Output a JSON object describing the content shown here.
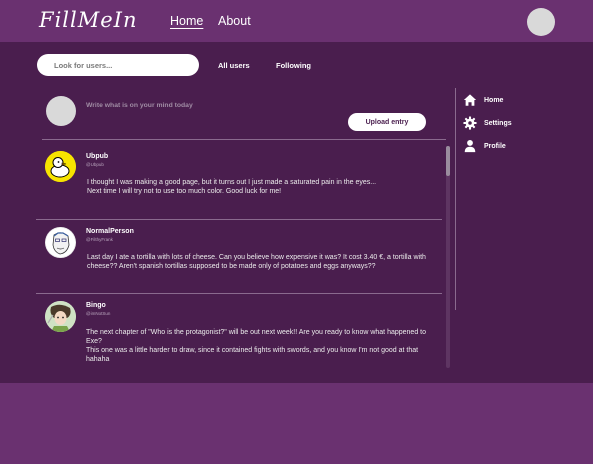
{
  "app": {
    "logo": "FillMeIn"
  },
  "nav": {
    "home": "Home",
    "about": "About"
  },
  "search": {
    "placeholder": "Look for users..."
  },
  "filters": {
    "all": "All users",
    "following": "Following"
  },
  "composer": {
    "placeholder": "Write what is on your mind today",
    "upload_label": "Upload entry"
  },
  "posts": [
    {
      "name": "Ubpub",
      "handle": "@Ubpub",
      "avatar_icon": "duck-avatar",
      "body": "I thought I was making a good page, but it turns out I just made a saturated pain in the eyes...\nNext time I will try not to use too much color. Good luck for me!"
    },
    {
      "name": "NormalPerson",
      "handle": "@FilthyFrank",
      "avatar_icon": "sketch-face-avatar",
      "body": "Last day I ate a tortilla with lots of cheese. Can you believe how expensive it was? It cost 3.40 €, a tortilla with cheese?? Aren't spanish tortillas supposed to be made only of potatoes and eggs anyways??"
    },
    {
      "name": "Bingo",
      "handle": "@imNotSun",
      "avatar_icon": "character-art-avatar",
      "body": "The next chapter of \"Who is the protagonist?\" will be out next week!! Are you ready to know what happened to Exe?\nThis one was a little harder to draw, since it contained fights with swords, and you know I'm not good at that hahaha"
    }
  ],
  "sidebar": {
    "items": [
      {
        "label": "Home",
        "icon": "house-icon"
      },
      {
        "label": "Settings",
        "icon": "gear-icon"
      },
      {
        "label": "Profile",
        "icon": "person-icon"
      }
    ]
  },
  "colors": {
    "header_bg": "#6a3170",
    "panel_bg": "#4a1e4e",
    "divider": "#8a6a8e",
    "accent_text": "#4a1e4e"
  }
}
